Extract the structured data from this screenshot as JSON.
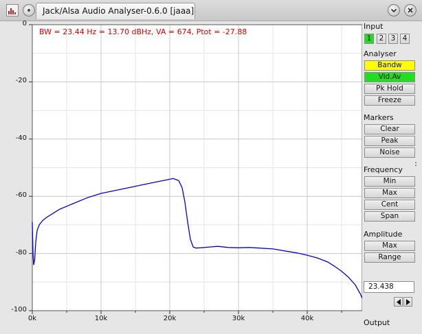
{
  "window": {
    "tab_title": "Jack/Alsa Audio Analyser-0.6.0  [jaaa]",
    "buttons": [
      "window-menu",
      "minimize",
      "close"
    ]
  },
  "plot": {
    "legend": "BW = 23.44 Hz = 13.70 dBHz, VA = 674, Ptot = -27.88",
    "trace_color": "#0000dd",
    "legend_color": "#e00000"
  },
  "chart_data": {
    "type": "line",
    "title": "",
    "xlabel": "",
    "ylabel": "",
    "xlim": [
      0,
      48000
    ],
    "ylim": [
      -100,
      0
    ],
    "grid": true,
    "x_ticks": [
      "0k",
      "10k",
      "20k",
      "30k",
      "40k"
    ],
    "x_tick_values": [
      0,
      10000,
      20000,
      30000,
      40000
    ],
    "y_ticks": [
      "0",
      "-20",
      "-40",
      "-60",
      "-80",
      "-100"
    ],
    "y_tick_values": [
      0,
      -20,
      -40,
      -60,
      -80,
      -100
    ],
    "series": [
      {
        "x": [
          0,
          100,
          200,
          350,
          500,
          700,
          1000,
          1500,
          2000,
          3000,
          4000,
          5000,
          6000,
          8000,
          10000,
          12000,
          14000,
          16000,
          18000,
          19500,
          20500,
          21300,
          21800,
          22200,
          22600,
          23000,
          23400,
          23800,
          24500,
          25500,
          27000,
          28500,
          30000,
          31500,
          33000,
          35000,
          37000,
          38500,
          40000,
          41500,
          43000,
          44000,
          45000,
          46000,
          47000,
          47700,
          48000
        ],
        "y": [
          -69,
          -80,
          -84,
          -82,
          -76,
          -72,
          -70,
          -68.5,
          -67.5,
          -66,
          -64.5,
          -63.5,
          -62.5,
          -60.5,
          -59,
          -58,
          -57,
          -56,
          -55,
          -54.3,
          -53.8,
          -54.5,
          -57,
          -62,
          -69,
          -75,
          -77.7,
          -78.1,
          -78,
          -77.8,
          -77.5,
          -77.9,
          -78,
          -77.9,
          -78.1,
          -78.4,
          -79.2,
          -79.8,
          -80.6,
          -81.6,
          -83,
          -84.5,
          -86.2,
          -88.3,
          -91,
          -94,
          -95.6
        ]
      }
    ]
  },
  "panel": {
    "input": {
      "label": "Input",
      "buttons": [
        "1",
        "2",
        "3",
        "4"
      ],
      "active": "1"
    },
    "analyser": {
      "label": "Analyser",
      "buttons": [
        "Bandw",
        "Vid.Av",
        "Pk Hold",
        "Freeze"
      ],
      "colors": [
        "#ffff00",
        "#22dd22",
        "",
        ""
      ]
    },
    "markers": {
      "label": "Markers",
      "buttons": [
        "Clear",
        "Peak",
        "Noise"
      ]
    },
    "frequency": {
      "label": "Frequency",
      "buttons": [
        "Min",
        "Max",
        "Cent",
        "Span"
      ]
    },
    "amplitude": {
      "label": "Amplitude",
      "buttons": [
        "Max",
        "Range"
      ]
    },
    "value": "23.438",
    "output_label": "Output"
  }
}
